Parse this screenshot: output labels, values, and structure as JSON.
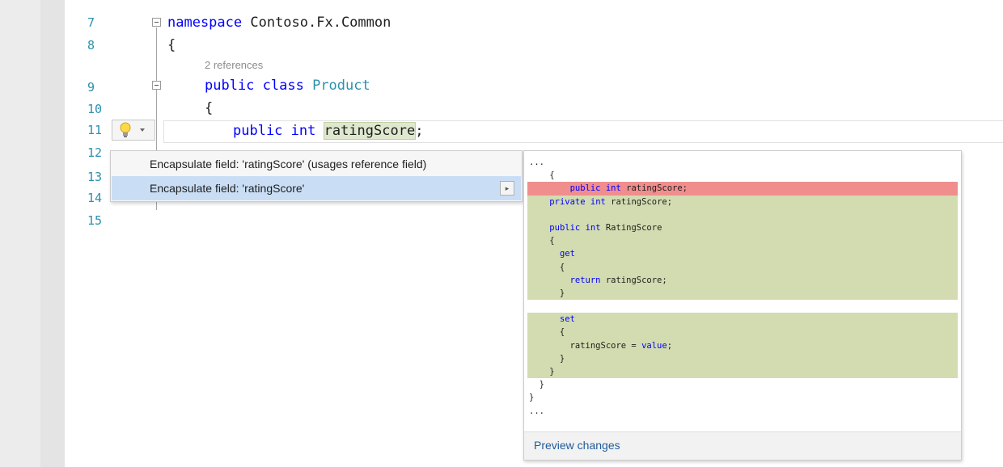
{
  "editor": {
    "lines": [
      {
        "num": "7",
        "parts": [
          "namespace",
          " Contoso.Fx.Common"
        ]
      },
      {
        "num": "8",
        "text": "{"
      },
      {
        "num": "9",
        "parts": [
          "public class",
          " ",
          "Product"
        ]
      },
      {
        "num": "10",
        "text": "{"
      },
      {
        "num": "11",
        "parts": [
          "public int",
          " ",
          "ratingScore",
          ";"
        ]
      },
      {
        "num": "12",
        "text": ""
      },
      {
        "num": "13",
        "text": ""
      },
      {
        "num": "14",
        "text": "}"
      },
      {
        "num": "15",
        "text": ""
      }
    ],
    "references_hint": "2 references"
  },
  "quick_actions": {
    "items": [
      {
        "label": "Encapsulate field: 'ratingScore' (usages reference field)",
        "selected": false
      },
      {
        "label": "Encapsulate field: 'ratingScore'",
        "selected": true
      }
    ],
    "submenu_glyph": "▸"
  },
  "preview": {
    "lines": [
      {
        "text": "...",
        "state": "normal"
      },
      {
        "text": "    {",
        "state": "normal"
      },
      {
        "text": "        public int ratingScore;",
        "state": "removed"
      },
      {
        "text": "    private int ratingScore;",
        "state": "added"
      },
      {
        "text": "",
        "state": "added"
      },
      {
        "text": "    public int RatingScore",
        "state": "added"
      },
      {
        "text": "    {",
        "state": "added"
      },
      {
        "text": "      get",
        "state": "added"
      },
      {
        "text": "      {",
        "state": "added"
      },
      {
        "text": "        return ratingScore;",
        "state": "added"
      },
      {
        "text": "      }",
        "state": "added"
      },
      {
        "text": "",
        "state": "normal"
      },
      {
        "text": "      set",
        "state": "added"
      },
      {
        "text": "      {",
        "state": "added"
      },
      {
        "text": "        ratingScore = value;",
        "state": "added"
      },
      {
        "text": "      }",
        "state": "added"
      },
      {
        "text": "    }",
        "state": "added"
      },
      {
        "text": "  }",
        "state": "normal"
      },
      {
        "text": "}",
        "state": "normal"
      },
      {
        "text": "...",
        "state": "normal"
      }
    ],
    "footer_link": "Preview changes"
  },
  "colors": {
    "removed": "#f08e8e",
    "added": "#d2dcb0",
    "selection": "#c9def5",
    "line_number": "#2b91af",
    "keyword": "#0000ff"
  },
  "icons": [
    "lightbulb-icon",
    "chevron-down-icon",
    "collapse-icon",
    "submenu-arrow-icon"
  ]
}
